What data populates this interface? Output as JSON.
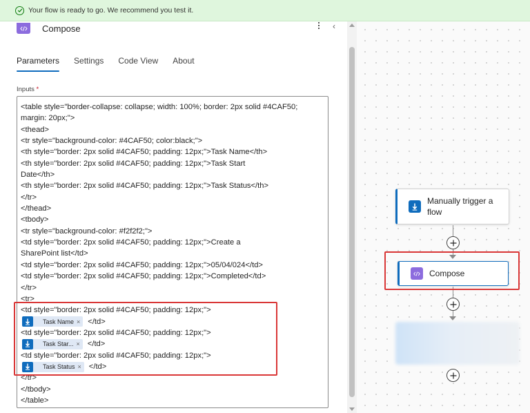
{
  "banner": {
    "message": "Your flow is ready to go. We recommend you test it.",
    "icon": "checkmark-circle-icon",
    "color": "#dff6dd"
  },
  "panel": {
    "title": "Compose",
    "tabs": [
      {
        "label": "Parameters",
        "active": true
      },
      {
        "label": "Settings"
      },
      {
        "label": "Code View"
      },
      {
        "label": "About"
      }
    ],
    "inputs_label": "Inputs",
    "required_mark": "*"
  },
  "code_lines": [
    "<table style=\"border-collapse: collapse; width: 100%; border: 2px solid #4CAF50;",
    "margin: 20px;\">",
    "    <thead>",
    "        <tr style=\"background-color: #4CAF50; color:black;\">",
    "            <th style=\"border: 2px solid #4CAF50; padding: 12px;\">Task Name</th>",
    "            <th style=\"border: 2px solid #4CAF50; padding: 12px;\">Task Start",
    "Date</th>",
    "            <th style=\"border: 2px solid #4CAF50; padding: 12px;\">Task Status</th>",
    "        </tr>",
    "    </thead>",
    "    <tbody>",
    "        <tr style=\"background-color: #f2f2f2;\">",
    "            <td style=\"border: 2px solid #4CAF50; padding: 12px;\">Create a",
    "SharePoint list</td>",
    "            <td style=\"border: 2px solid #4CAF50; padding: 12px;\">05/04/024</td>",
    "            <td style=\"border: 2px solid #4CAF50; padding: 12px;\">Completed</td>",
    "        </tr>",
    "        <tr>",
    "            <td style=\"border: 2px solid #4CAF50; padding: 12px;\">",
    "            <td style=\"border: 2px solid #4CAF50; padding: 12px;\">",
    "            <td style=\"border: 2px solid #4CAF50; padding: 12px;\">",
    "        </tr>",
    "    </tbody>",
    "</table>"
  ],
  "tokens": [
    {
      "label": "Task Name",
      "close": "×",
      "after": "</td>"
    },
    {
      "label": "Task Star...",
      "close": "×",
      "after": "</td>"
    },
    {
      "label": "Task Status",
      "close": "×",
      "after": "</td>"
    }
  ],
  "flow": {
    "trigger": {
      "label": "Manually trigger a flow",
      "icon": "manual-trigger-icon",
      "color": "#0f6cbd"
    },
    "compose": {
      "label": "Compose",
      "icon": "compose-code-icon",
      "color": "#8c6cde"
    }
  },
  "colors": {
    "accent": "#0f6cbd",
    "highlight_border": "#d93636"
  }
}
